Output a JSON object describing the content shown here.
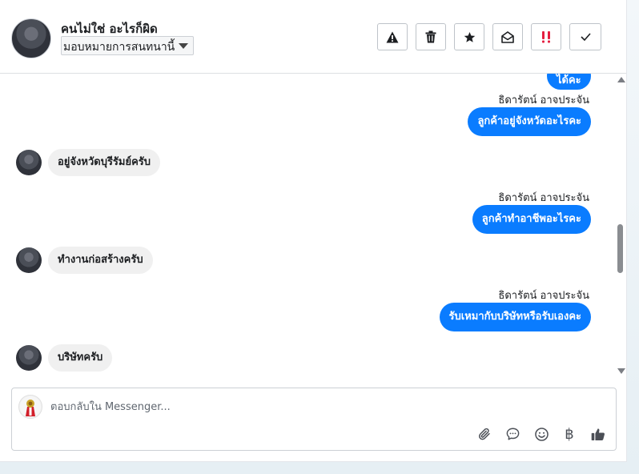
{
  "header": {
    "contact_name": "คนไม่ใช่ อะไรก็ผิด",
    "assign_selected": "มอบหมายการสนทนานี้",
    "tools": [
      "mark-spam-icon",
      "delete-icon",
      "star-icon",
      "mark-unread-icon",
      "priority-icon",
      "done-icon"
    ]
  },
  "thread": {
    "top_partial_message": "ได้คะ",
    "messages": [
      {
        "direction": "out",
        "sender": "ธิดารัตน์ อาจประจัน",
        "text": "ลูกค้าอยู่จังหวัดอะไรคะ"
      },
      {
        "direction": "in",
        "text": "อยู่จังหวัดบุรีรัมย์ครับ"
      },
      {
        "direction": "out",
        "sender": "ธิดารัตน์ อาจประจัน",
        "text": "ลูกค้าทำอาชีพอะไรคะ"
      },
      {
        "direction": "in",
        "text": "ทำงานก่อสร้างครับ"
      },
      {
        "direction": "out",
        "sender": "ธิดารัตน์ อาจประจัน",
        "text": "รับเหมากับบริษัทหรือรับเองคะ"
      },
      {
        "direction": "in",
        "text": "บริษัทครับ"
      }
    ]
  },
  "composer": {
    "placeholder": "ตอบกลับใน Messenger...",
    "actions": [
      "attach-icon",
      "saved-replies-icon",
      "emoji-icon",
      "payment-icon",
      "like-icon"
    ],
    "payment_glyph": "฿"
  },
  "colors": {
    "outgoing_bubble": "#0a7cff",
    "incoming_bubble": "#f0f0f0",
    "priority_icon": "#e41e3f"
  }
}
